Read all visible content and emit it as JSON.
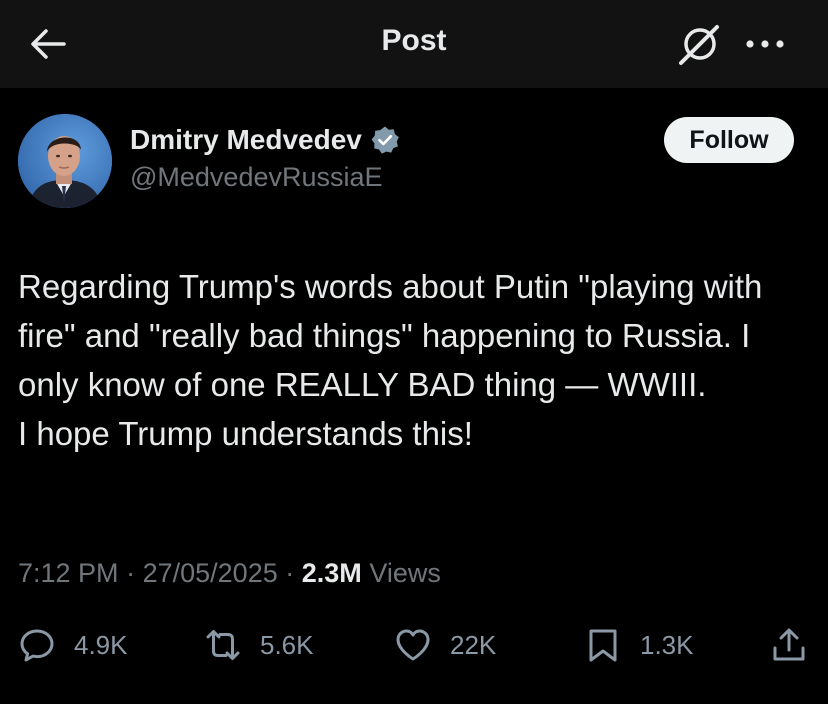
{
  "header": {
    "title": "Post",
    "icons": {
      "back": "arrow-left-icon",
      "grok": "grok-icon",
      "more": "more-icon"
    }
  },
  "author": {
    "name": "Dmitry Medvedev",
    "handle": "@MedvedevRussiaE",
    "verified_icon": "verified-badge-icon",
    "follow_label": "Follow"
  },
  "post": {
    "lines": [
      "Regarding Trump's words about Putin \"playing with fire\" and \"really bad things\" happening to Russia. I only know of one REALLY BAD thing — WWIII.",
      "I hope Trump understands this!"
    ],
    "time": "7:12 PM",
    "separator": "·",
    "date": "27/05/2025",
    "views_count": "2.3M",
    "views_label": "Views"
  },
  "actions": {
    "replies": "4.9K",
    "reposts": "5.6K",
    "likes": "22K",
    "bookmarks": "1.3K"
  },
  "colors": {
    "background": "#000000",
    "header_bg": "#121212",
    "text": "#e7e9ea",
    "secondary_text": "#71767b",
    "verified": "#829aab",
    "follow_bg": "#eff3f4"
  }
}
